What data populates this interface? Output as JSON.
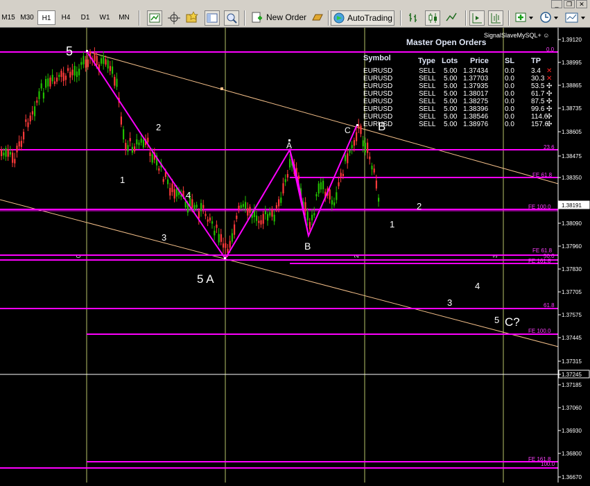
{
  "window_controls": {
    "minimize": "_",
    "restore": "❐",
    "close": "✕"
  },
  "toolbar": {
    "timeframes": [
      "M15",
      "M30",
      "H1",
      "H4",
      "D1",
      "W1",
      "MN"
    ],
    "active_timeframe": "H1",
    "new_order_label": "New Order",
    "autotrading_label": "AutoTrading",
    "icons": [
      "chart-properties-icon",
      "crosshair-icon",
      "templates-icon",
      "navigator-icon",
      "zoom-icon",
      "new-order-icon",
      "gold-bar-icon",
      "autotrading-icon",
      "bar-chart-icon",
      "candlestick-icon",
      "line-chart-icon",
      "shift-icon",
      "autoscroll-icon",
      "indicators-icon",
      "periods-clock-icon",
      "templates-menu-icon"
    ]
  },
  "chart": {
    "price_axis": [
      "1.39120",
      "1.38995",
      "1.38865",
      "1.38735",
      "1.38605",
      "1.38475",
      "1.38350",
      "1.38191",
      "1.38090",
      "1.37960",
      "1.37830",
      "1.37705",
      "1.37575",
      "1.37445",
      "1.37315",
      "1.37245",
      "1.37185",
      "1.37060",
      "1.36930",
      "1.36800",
      "1.36670"
    ],
    "current_price": "1.38191",
    "bid_line_price": "1.37245",
    "fib_labels": [
      "0.0",
      "23.6",
      "FE 61.8",
      "FE 100.0",
      "FE 61.8",
      "50.0",
      "FE 161.8",
      "61.8",
      "FE 100.0",
      "FE 161.8",
      "100.0"
    ],
    "wave_labels": [
      "5",
      "2",
      "1",
      "4",
      "3",
      "5 A",
      "A",
      "B",
      "C",
      "B",
      "2",
      "1",
      "3",
      "4",
      "5",
      "C?"
    ],
    "period_separators": [
      "0",
      "2",
      "3"
    ]
  },
  "orders": {
    "title": "Master Open Orders",
    "signal_label": "SignalSlaveMySQL+ ☺",
    "headers": {
      "symbol": "Symbol",
      "type": "Type",
      "lots": "Lots",
      "price": "Price",
      "sl": "SL",
      "tp": "TP"
    },
    "rows": [
      {
        "symbol": "EURUSD",
        "type": "SELL",
        "lots": "5.00",
        "price": "1.37434",
        "sl": "0.0",
        "tp": "3.4",
        "mark": "✕"
      },
      {
        "symbol": "EURUSD",
        "type": "SELL",
        "lots": "5.00",
        "price": "1.37703",
        "sl": "0.0",
        "tp": "30.3",
        "mark": "✕"
      },
      {
        "symbol": "EURUSD",
        "type": "SELL",
        "lots": "5.00",
        "price": "1.37935",
        "sl": "0.0",
        "tp": "53.5",
        "mark": "✣"
      },
      {
        "symbol": "EURUSD",
        "type": "SELL",
        "lots": "5.00",
        "price": "1.38017",
        "sl": "0.0",
        "tp": "61.7",
        "mark": "✣"
      },
      {
        "symbol": "EURUSD",
        "type": "SELL",
        "lots": "5.00",
        "price": "1.38275",
        "sl": "0.0",
        "tp": "87.5",
        "mark": "✣"
      },
      {
        "symbol": "EURUSD",
        "type": "SELL",
        "lots": "5.00",
        "price": "1.38396",
        "sl": "0.0",
        "tp": "99.6",
        "mark": "✣"
      },
      {
        "symbol": "EURUSD",
        "type": "SELL",
        "lots": "5.00",
        "price": "1.38546",
        "sl": "0.0",
        "tp": "114.6",
        "mark": "✣"
      },
      {
        "symbol": "EURUSD",
        "type": "SELL",
        "lots": "5.00",
        "price": "1.38976",
        "sl": "0.0",
        "tp": "157.6",
        "mark": "✣"
      }
    ]
  },
  "colors": {
    "background": "#000000",
    "fib": "#ff00ff",
    "trend": "#f5c08a",
    "bull": "#22c000",
    "bear": "#ff3a3a",
    "vline": "#b8c46a",
    "mark_close": "#ff2020"
  }
}
